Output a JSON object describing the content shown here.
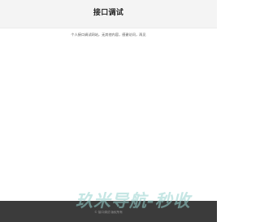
{
  "header": {
    "title": "接口调试"
  },
  "main": {
    "subtitle": "个人接口调试网站，无其他内容，感谢访问，再见"
  },
  "footer": {
    "copyright": "© 接口调试 版权所有"
  },
  "watermark": {
    "text": "玖米导航-秒收"
  },
  "colors": {
    "header_bg": "#f4f4f4",
    "footer_bg": "#3b3b3b",
    "watermark": "#96d2cd"
  }
}
